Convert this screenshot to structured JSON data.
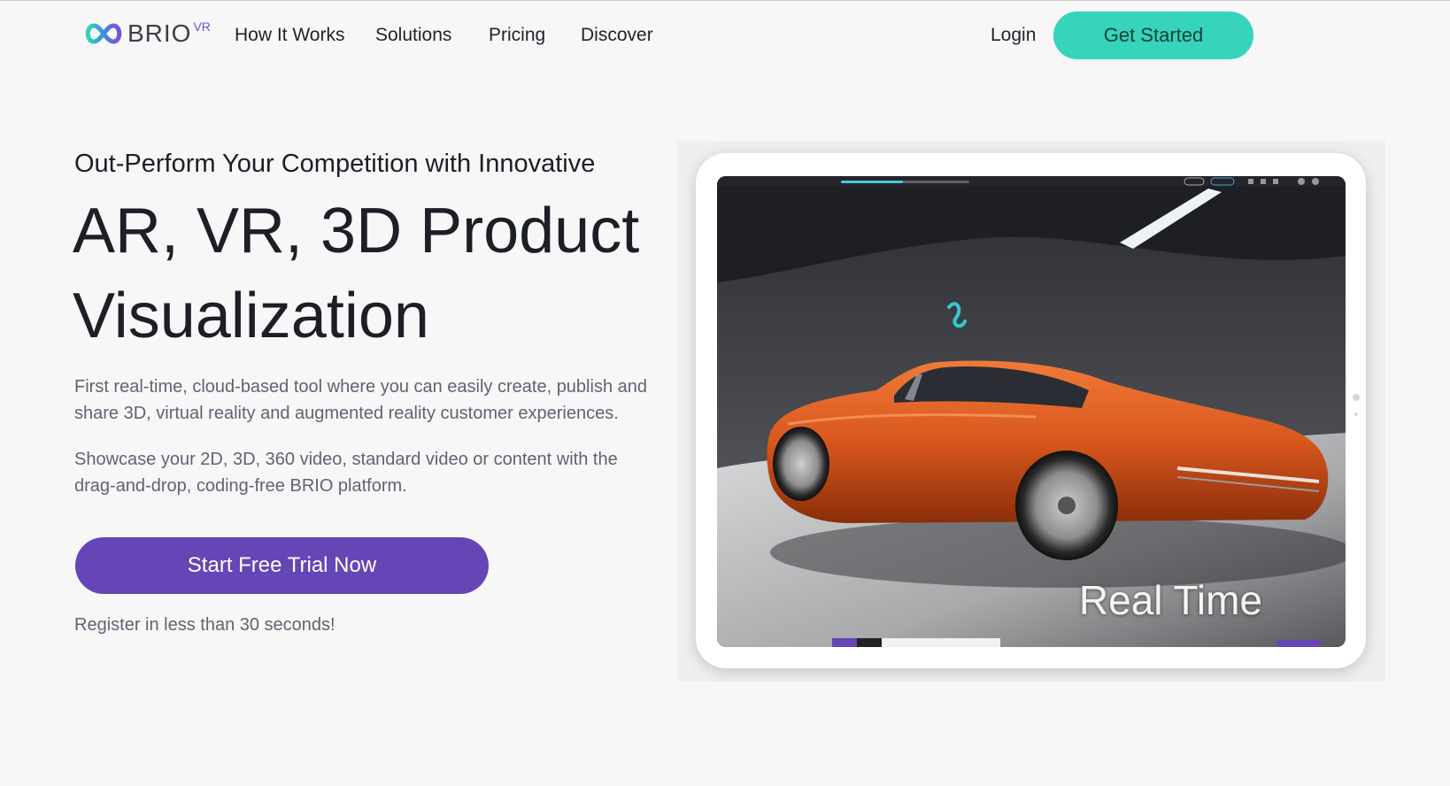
{
  "brand": {
    "name": "BRIO",
    "superscript": "VR"
  },
  "nav": {
    "links": [
      "How It Works",
      "Solutions",
      "Pricing",
      "Discover"
    ],
    "login": "Login",
    "get_started": "Get Started"
  },
  "hero": {
    "eyebrow": "Out-Perform Your Competition with Innovative",
    "headline_line1": "AR, VR, 3D Product",
    "headline_line2": "Visualization",
    "paragraph1": "First real-time, cloud-based tool where you can easily create, publish and share 3D, virtual reality and augmented reality customer experiences.",
    "paragraph2": "Showcase your 2D, 3D, 360 video, standard video or content with the drag-and-drop, coding-free BRIO platform.",
    "cta": "Start Free Trial Now",
    "register_note": "Register in less than 30 seconds!"
  },
  "preview": {
    "overlay_text": "Real Time"
  },
  "colors": {
    "accent_teal": "#36d4ba",
    "accent_purple": "#6645b6",
    "car_orange": "#d8571c"
  }
}
